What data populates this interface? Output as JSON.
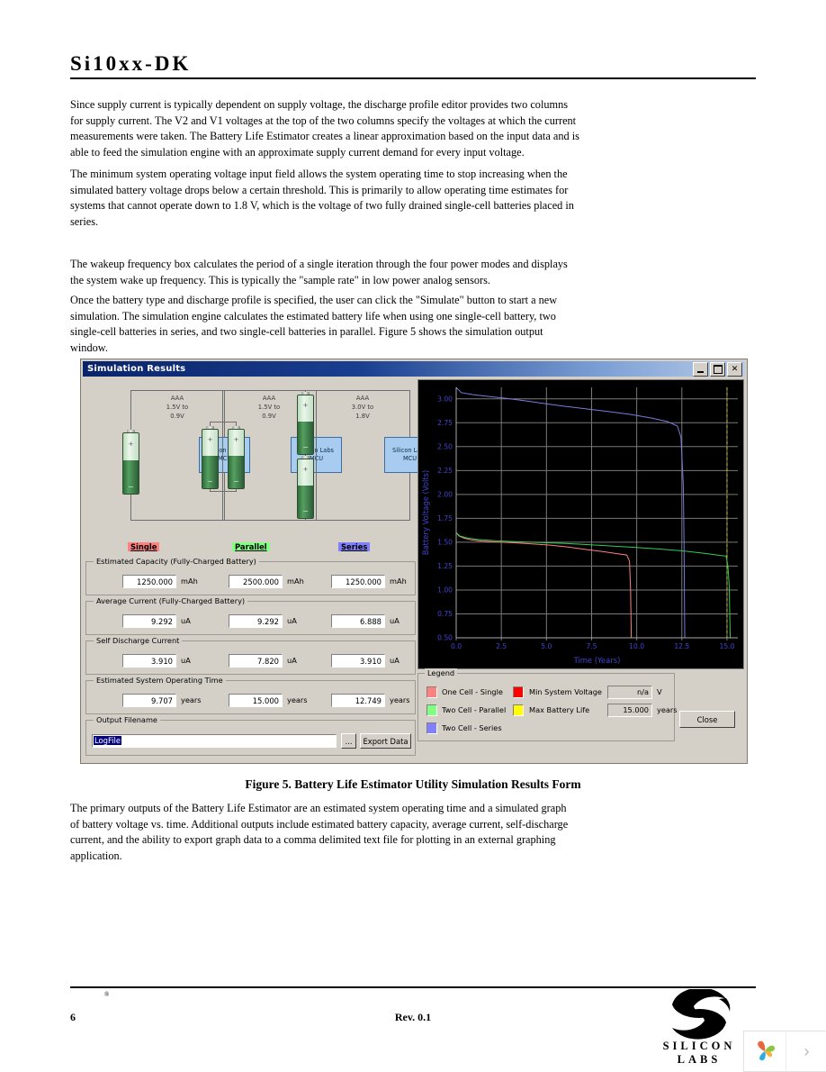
{
  "document": {
    "title": "Si10xx-DK",
    "paragraphs": [
      "Since supply current is typically dependent on supply voltage, the discharge profile editor provides two columns for supply current. The V2 and V1 voltages at the top of the two columns specify the voltages at which the current measurements were taken. The Battery Life Estimator creates a linear approximation based on the input data and is able to feed the simulation engine with an approximate supply current demand for every input voltage.",
      "The minimum system operating voltage input field allows the system operating time to stop increasing when the simulated battery voltage drops below a certain threshold. This is primarily to allow operating time estimates for systems that cannot operate down to 1.8 V, which is the voltage of two fully drained single-cell batteries placed in series.",
      "The wakeup frequency box calculates the period of a single iteration through the four power modes and displays the system wake up frequency. This is typically the \"sample rate\" in low power analog sensors.",
      "Once the battery type and discharge profile is specified, the user can click the \"Simulate\" button to start a new simulation. The simulation engine calculates the estimated battery life when using one single-cell battery, two single-cell batteries in series, and two single-cell batteries in parallel. Figure 5 shows the simulation output window.",
      "The primary outputs of the Battery Life Estimator are an estimated system operating time and a simulated graph of battery voltage vs. time. Additional outputs include estimated battery capacity, average current, self-discharge current, and the ability to export graph data to a comma delimited text file for plotting in an external graphing application."
    ],
    "figure_caption": "Figure 5. Battery Life Estimator Utility Simulation Results Form",
    "footer": {
      "page_number": "6",
      "revision": "Rev. 0.1",
      "logo_text": "SILICON LABS",
      "registered_mark": "®"
    },
    "page_turner": {
      "next_glyph": "›"
    }
  },
  "sim_window": {
    "title": "Simulation Results",
    "window_buttons": [
      {
        "name": "minimize",
        "glyph": "_"
      },
      {
        "name": "maximize",
        "glyph": "□"
      },
      {
        "name": "close",
        "glyph": "✕"
      }
    ],
    "diagram": {
      "configs": [
        {
          "id": "single",
          "spec": "AAA\n1.5V to\n0.9V",
          "mcu": "Silicon Labs\nMCU",
          "cells": 1
        },
        {
          "id": "parallel",
          "spec": "AAA\n1.5V to\n0.9V",
          "mcu": "Silicon Labs\nMCU",
          "cells": 2
        },
        {
          "id": "series",
          "spec": "AAA\n3.0V to\n1.8V",
          "mcu": "Silicon Labs\nMCU",
          "cells": 2
        }
      ],
      "battery_plus": "+",
      "battery_minus": "−"
    },
    "columns": [
      {
        "label": "Single",
        "highlight": "#ff8080"
      },
      {
        "label": "Parallel",
        "highlight": "#80ff80"
      },
      {
        "label": "Series",
        "highlight": "#8080ff"
      }
    ],
    "groups": [
      {
        "title": "Estimated Capacity (Fully-Charged Battery)",
        "unit": "mAh",
        "values": [
          "1250.000",
          "2500.000",
          "1250.000"
        ]
      },
      {
        "title": "Average Current (Fully-Charged Battery)",
        "unit": "uA",
        "values": [
          "9.292",
          "9.292",
          "6.888"
        ]
      },
      {
        "title": "Self Discharge Current",
        "unit": "uA",
        "values": [
          "3.910",
          "7.820",
          "3.910"
        ]
      },
      {
        "title": "Estimated System Operating Time",
        "unit": "years",
        "values": [
          "9.707",
          "15.000",
          "12.749"
        ]
      }
    ],
    "output": {
      "title": "Output Filename",
      "filename": "LogFile",
      "browse_label": "...",
      "export_label": "Export Data"
    },
    "legend": {
      "title": "Legend",
      "series": [
        {
          "label": "One Cell - Single",
          "color": "#ff8080"
        },
        {
          "label": "Two Cell - Parallel",
          "color": "#80ff80"
        },
        {
          "label": "Two Cell - Series",
          "color": "#8080ff"
        }
      ],
      "markers": [
        {
          "label": "Min System Voltage",
          "color": "#ff0000",
          "value": "n/a",
          "unit": "V"
        },
        {
          "label": "Max Battery Life",
          "color": "#ffff00",
          "value": "15.000",
          "unit": "years"
        }
      ]
    },
    "close_label": "Close"
  },
  "chart_data": {
    "type": "line",
    "title": "",
    "xlabel": "Time (Years)",
    "ylabel": "Battery Voltage (Volts)",
    "xlim": [
      0.0,
      15.6
    ],
    "ylim": [
      0.5,
      3.12
    ],
    "xticks": [
      "0.0",
      "2.5",
      "5.0",
      "7.5",
      "10.0",
      "12.5",
      "15.0"
    ],
    "xtick_values": [
      0.0,
      2.5,
      5.0,
      7.5,
      10.0,
      12.5,
      15.0
    ],
    "yticks": [
      "0.50",
      "0.75",
      "1.00",
      "1.25",
      "1.50",
      "1.75",
      "2.00",
      "2.25",
      "2.50",
      "2.75",
      "3.00"
    ],
    "ytick_values": [
      0.5,
      0.75,
      1.0,
      1.25,
      1.5,
      1.75,
      2.0,
      2.25,
      2.5,
      2.75,
      3.0
    ],
    "grid": true,
    "background": "#000000",
    "grid_color": "#7a7a7a",
    "axis_text_color": "#4444cc",
    "legend_position": "external",
    "series": [
      {
        "name": "One Cell - Single",
        "color": "#ff8080",
        "points": [
          [
            0.0,
            1.6
          ],
          [
            0.15,
            1.565
          ],
          [
            0.4,
            1.545
          ],
          [
            0.8,
            1.525
          ],
          [
            1.4,
            1.512
          ],
          [
            2.2,
            1.503
          ],
          [
            3.2,
            1.494
          ],
          [
            4.2,
            1.483
          ],
          [
            5.2,
            1.47
          ],
          [
            6.2,
            1.449
          ],
          [
            7.2,
            1.424
          ],
          [
            8.2,
            1.4
          ],
          [
            9.0,
            1.378
          ],
          [
            9.45,
            1.366
          ],
          [
            9.6,
            1.3
          ],
          [
            9.66,
            1.0
          ],
          [
            9.7,
            0.5
          ]
        ]
      },
      {
        "name": "Two Cell - Parallel",
        "color": "#33cc55",
        "points": [
          [
            0.0,
            1.6
          ],
          [
            0.2,
            1.565
          ],
          [
            0.6,
            1.545
          ],
          [
            1.2,
            1.528
          ],
          [
            2.2,
            1.515
          ],
          [
            3.4,
            1.505
          ],
          [
            4.6,
            1.497
          ],
          [
            5.8,
            1.489
          ],
          [
            7.0,
            1.478
          ],
          [
            8.4,
            1.462
          ],
          [
            9.8,
            1.447
          ],
          [
            11.2,
            1.429
          ],
          [
            12.6,
            1.408
          ],
          [
            13.8,
            1.382
          ],
          [
            14.6,
            1.362
          ],
          [
            14.95,
            1.355
          ],
          [
            15.05,
            1.25
          ],
          [
            15.12,
            1.05
          ],
          [
            15.18,
            0.5
          ]
        ]
      },
      {
        "name": "Two Cell - Series",
        "color": "#7a7ae0",
        "points": [
          [
            0.0,
            3.12
          ],
          [
            0.28,
            3.065
          ],
          [
            0.9,
            3.045
          ],
          [
            1.8,
            3.025
          ],
          [
            2.8,
            3.005
          ],
          [
            3.8,
            2.98
          ],
          [
            4.9,
            2.95
          ],
          [
            6.0,
            2.922
          ],
          [
            7.2,
            2.895
          ],
          [
            8.4,
            2.868
          ],
          [
            9.6,
            2.838
          ],
          [
            10.8,
            2.8
          ],
          [
            11.7,
            2.762
          ],
          [
            12.25,
            2.716
          ],
          [
            12.45,
            2.6
          ],
          [
            12.58,
            2.1
          ],
          [
            12.62,
            1.5
          ],
          [
            12.66,
            0.5
          ]
        ]
      }
    ],
    "vlines": [
      {
        "name": "Max Battery Life",
        "x": 15.0,
        "color": "#cccc00",
        "style": "dashed"
      }
    ]
  }
}
